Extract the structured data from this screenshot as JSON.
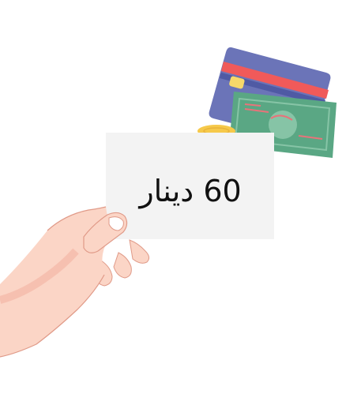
{
  "price_card": {
    "label": "60 دينار"
  },
  "illustration": {
    "icons": [
      "credit-card-icon",
      "banknote-icon",
      "coin-stack-icon",
      "hand-icon"
    ],
    "colors": {
      "card_body": "#6b74b8",
      "card_stripe": "#f05a5a",
      "card_chip": "#f7d86a",
      "banknote": "#5aa784",
      "banknote_light": "#86c4a6",
      "banknote_accent": "#e8737a",
      "coin": "#f6c94a",
      "coin_edge": "#e8b33a",
      "price_card": "#f3f3f3",
      "skin": "#fbd5c6",
      "skin_shadow": "#f4b2a1",
      "outline": "#e09a88"
    }
  }
}
